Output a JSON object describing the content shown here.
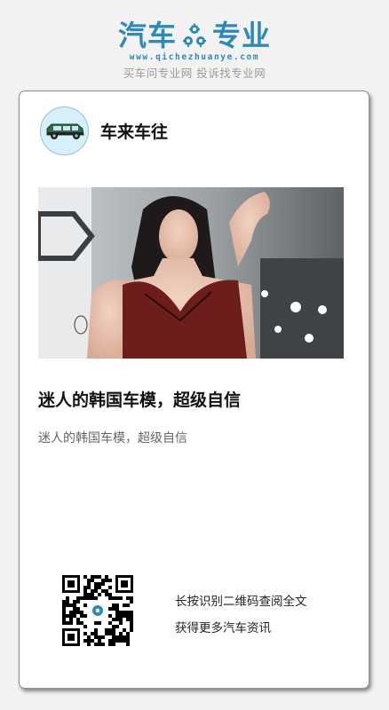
{
  "header": {
    "logo_left": "汽车",
    "logo_right": "专业",
    "logo_url": "www.qichezhuanye.com",
    "slogan": "买车问专业网 投诉找专业网"
  },
  "card": {
    "author": {
      "name": "车来车往",
      "avatar_icon": "car-icon"
    },
    "hero_image": "photo",
    "title": "迷人的韩国车模，超级自信",
    "summary": "迷人的韩国车模，超级自信",
    "qr": {
      "line1": "长按识别二维码查阅全文",
      "line2": "获得更多汽车资讯"
    }
  },
  "colors": {
    "brand": "#2d89b9",
    "page_bg": "#f2f2f2",
    "card_bg": "#ffffff"
  }
}
